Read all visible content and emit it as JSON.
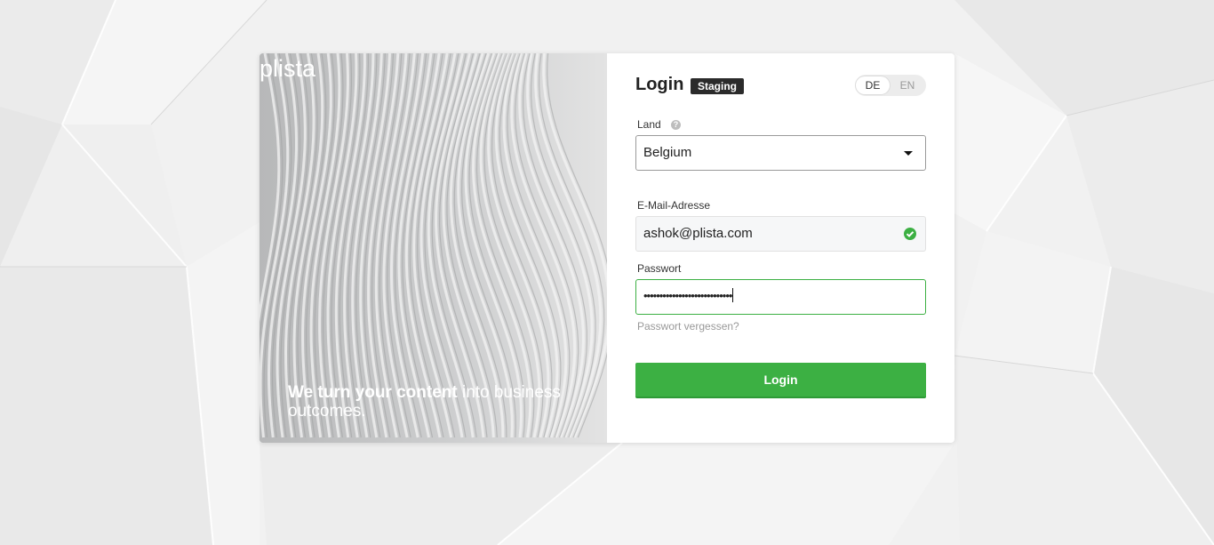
{
  "brand": {
    "logo_text": "plista",
    "tagline_bold": "We turn your content",
    "tagline_rest": " into business outcomes."
  },
  "login": {
    "title": "Login",
    "env_badge": "Staging",
    "languages": [
      "DE",
      "EN"
    ],
    "selected_language": "DE"
  },
  "country": {
    "label": "Land",
    "help_icon": "question-circle-icon",
    "value": "Belgium"
  },
  "email": {
    "label": "E-Mail-Adresse",
    "value": "ashok@plista.com",
    "valid_icon": "check-circle-icon"
  },
  "password": {
    "label": "Passwort",
    "masked_value": "••••••••••••••••••••••••••••",
    "forgot_link": "Passwort vergessen?"
  },
  "submit": {
    "label": "Login"
  },
  "colors": {
    "accent_green": "#3cb043",
    "badge_dark": "#2b2b2b"
  }
}
